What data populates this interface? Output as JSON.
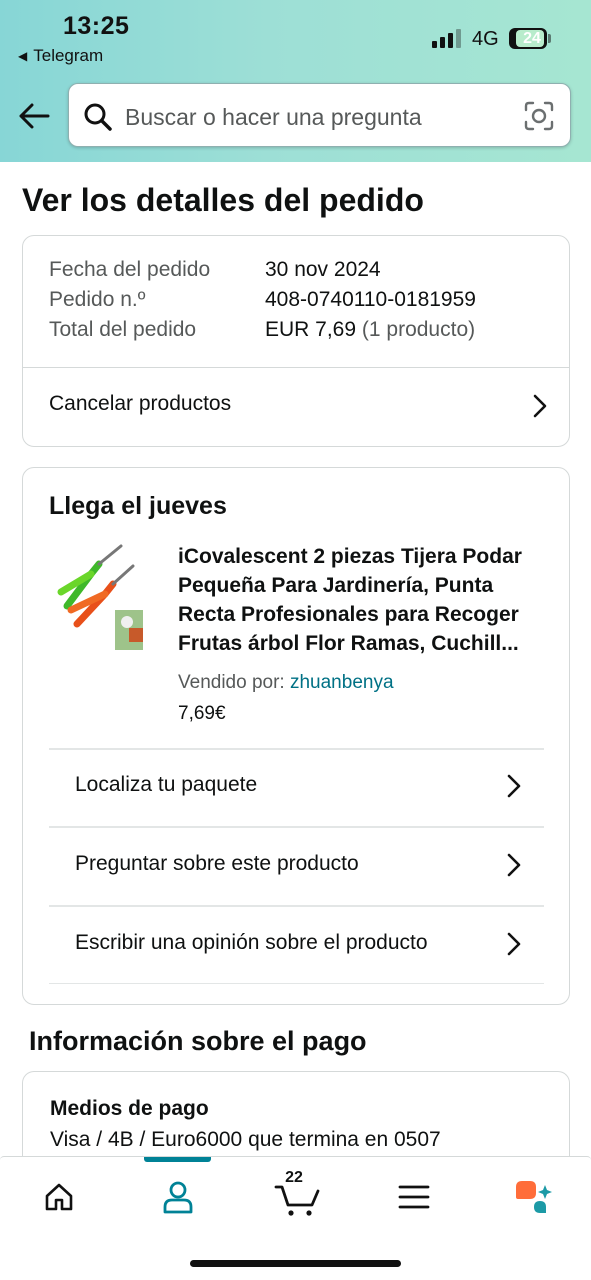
{
  "status_bar": {
    "time": "13:25",
    "back_app": "Telegram",
    "network": "4G",
    "battery": "24"
  },
  "search": {
    "placeholder": "Buscar o hacer una pregunta"
  },
  "page": {
    "title": "Ver los detalles del pedido"
  },
  "order_summary": {
    "rows": [
      {
        "label": "Fecha del pedido",
        "value": "30 nov 2024"
      },
      {
        "label": "Pedido n.º",
        "value": "408-0740110-0181959"
      },
      {
        "label": "Total del pedido",
        "value": "EUR 7,69",
        "extra": "(1 producto)"
      }
    ],
    "cancel_label": "Cancelar productos"
  },
  "shipment": {
    "arrival": "Llega el jueves",
    "product_title": "iCovalescent 2 piezas Tijera Podar Pequeña Para Jardinería, Punta Recta Profesionales para Recoger Frutas árbol Flor Ramas, Cuchill...",
    "sold_by_label": "Vendido por:",
    "seller_name": "zhuanbenya",
    "price": "7,69€",
    "actions": [
      "Localiza tu paquete",
      "Preguntar sobre este producto",
      "Escribir una opinión sobre el producto"
    ]
  },
  "payment": {
    "section_title": "Información sobre el pago",
    "methods_title": "Medios de pago",
    "method_value": "Visa / 4B / Euro6000  que termina en 0507"
  },
  "bottom_nav": {
    "items": [
      "home-icon",
      "account-icon",
      "cart-icon",
      "menu-icon",
      "rufus-icon"
    ],
    "active": "account-icon",
    "cart_count": "22"
  },
  "colors": {
    "header_gradient": [
      "#87d6d6",
      "#a6e6d2"
    ],
    "link": "#007185",
    "active_nav": "#008296",
    "rufus_orange": "#ff6d3a",
    "rufus_teal": "#1c9aa6"
  }
}
